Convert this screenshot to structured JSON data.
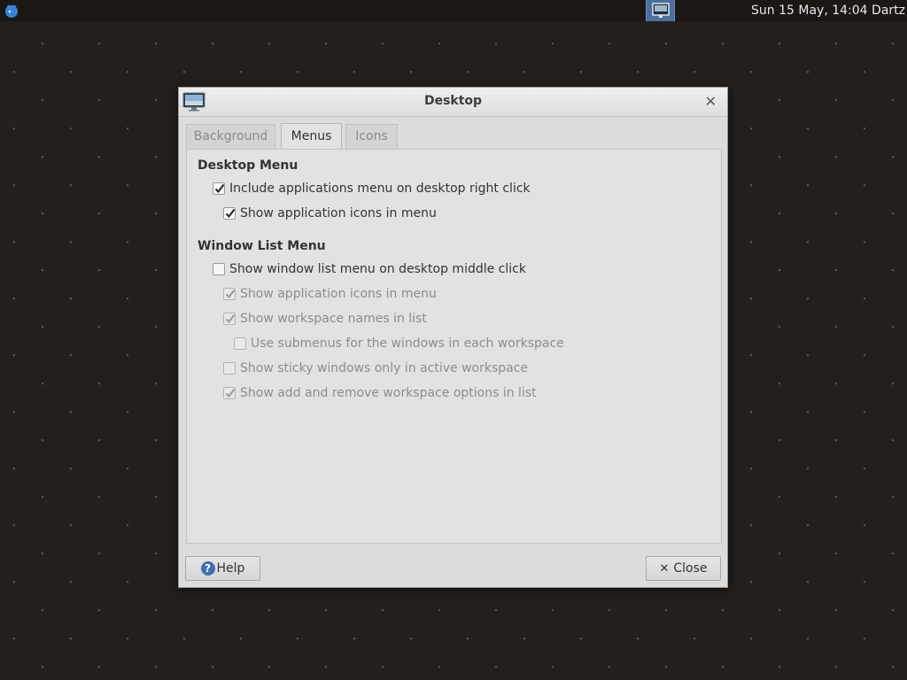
{
  "panel": {
    "clock": "Sun 15 May, 14:04 Dartz"
  },
  "dialog": {
    "title": "Desktop",
    "tabs": [
      {
        "label": "Background",
        "active": false
      },
      {
        "label": "Menus",
        "active": true
      },
      {
        "label": "Icons",
        "active": false
      }
    ],
    "desktop_menu": {
      "heading": "Desktop Menu",
      "options": [
        {
          "label": "Include applications menu on desktop right click",
          "checked": true,
          "enabled": true
        },
        {
          "label": "Show application icons in menu",
          "checked": true,
          "enabled": true
        }
      ]
    },
    "window_list_menu": {
      "heading": "Window List Menu",
      "options": [
        {
          "label": "Show window list menu on desktop middle click",
          "checked": false,
          "enabled": true
        },
        {
          "label": "Show application icons in menu",
          "checked": true,
          "enabled": false
        },
        {
          "label": "Show workspace names in list",
          "checked": true,
          "enabled": false
        },
        {
          "label": "Use submenus for the windows in each workspace",
          "checked": false,
          "enabled": false
        },
        {
          "label": "Show sticky windows only in active workspace",
          "checked": false,
          "enabled": false
        },
        {
          "label": "Show add and remove workspace options in list",
          "checked": true,
          "enabled": false
        }
      ]
    },
    "buttons": {
      "help": "Help",
      "close": "Close"
    }
  },
  "colors": {
    "desktop_bg": "#231f1c",
    "accent": "#3f6fb6"
  }
}
